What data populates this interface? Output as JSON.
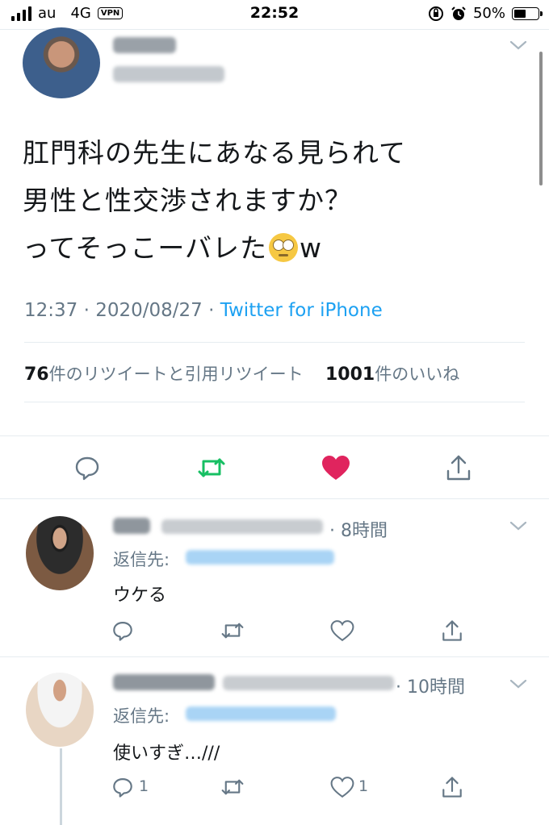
{
  "status_bar": {
    "carrier": "au",
    "network": "4G",
    "vpn": "VPN",
    "time": "22:52",
    "battery": "50%",
    "battery_level": 0.5
  },
  "tweet": {
    "lines": [
      "肛門科の先生にあなる見られて",
      "男性と性交渉されますか？",
      "ってそっこーバレた"
    ],
    "line3_suffix": "w",
    "emoji": "face-with-rolling-eyes",
    "time": "12:37",
    "date": "2020/08/27",
    "separator": "·",
    "client": "Twitter for iPhone",
    "retweet_count": "76",
    "retweet_label": "件のリツイートと引用リツイート",
    "like_count": "1001",
    "like_label": "件のいいね",
    "liked": true,
    "like_color": "#e0245e",
    "retweet_color": "#17bf63"
  },
  "replies": [
    {
      "time_ago": "· 8時間",
      "reply_to_label": "返信先:",
      "text": "ウケる",
      "reply_count": "",
      "like_count": ""
    },
    {
      "time_ago": "· 10時間",
      "reply_to_label": "返信先:",
      "text": "使いすぎ…///",
      "reply_count": "1",
      "like_count": "1"
    }
  ]
}
